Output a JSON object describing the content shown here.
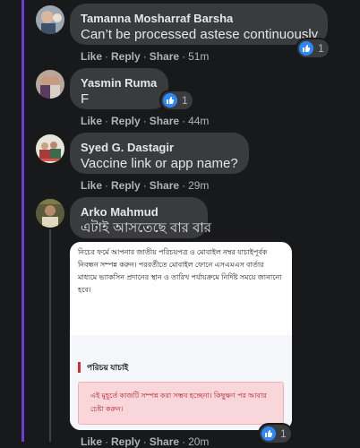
{
  "comments": [
    {
      "author": "Tamanna Mosharraf Barsha",
      "text": "Can’t be processed astese continuously",
      "reactions": "1",
      "time": "51m"
    },
    {
      "author": "Yasmin Ruma",
      "text": "F",
      "reactions": "1",
      "time": "44m"
    },
    {
      "author": "Syed G. Dastagir",
      "text": "Vaccine link or app name?",
      "time": "29m"
    },
    {
      "author": "Arko Mahmud",
      "text": "এটাই আসতেছে বার বার",
      "reactions": "1",
      "time": "20m"
    }
  ],
  "actions": {
    "like": "Like",
    "reply": "Reply",
    "share": "Share",
    "sep": "·"
  },
  "attachment": {
    "intro": "নিচের ফর্মে আপনার জাতীয় পরিচয়পত্র ও মোবাইল নম্বর যাচাইপূর্বক নিবন্ধন সম্পন্ন করুন। পরবর্তীতে মোবাইল ফোনে এসএমএস বার্তার মাধ্যমে ভ্যাকসিন প্রদানের স্থান ও তারিখ পর্যায়ক্রমে নির্দিষ্ট সময়ে জানানো হবে।",
    "heading": "পরিচয় যাচাই",
    "alert": "এই মুহূর্তে কাজটি সম্পন্ন করা সম্ভব হচ্ছেনা। কিছুক্ষণ পর আবার চেষ্টা করুন।"
  },
  "colors": {
    "background": "#18191a",
    "bubble": "#3a3b3c",
    "accent_line": "#6b3fd6",
    "like_blue": "#2d88ff",
    "alert_bg": "#f9d6da",
    "alert_text": "#b3262e"
  },
  "icons": [
    "avatar",
    "like-icon"
  ]
}
